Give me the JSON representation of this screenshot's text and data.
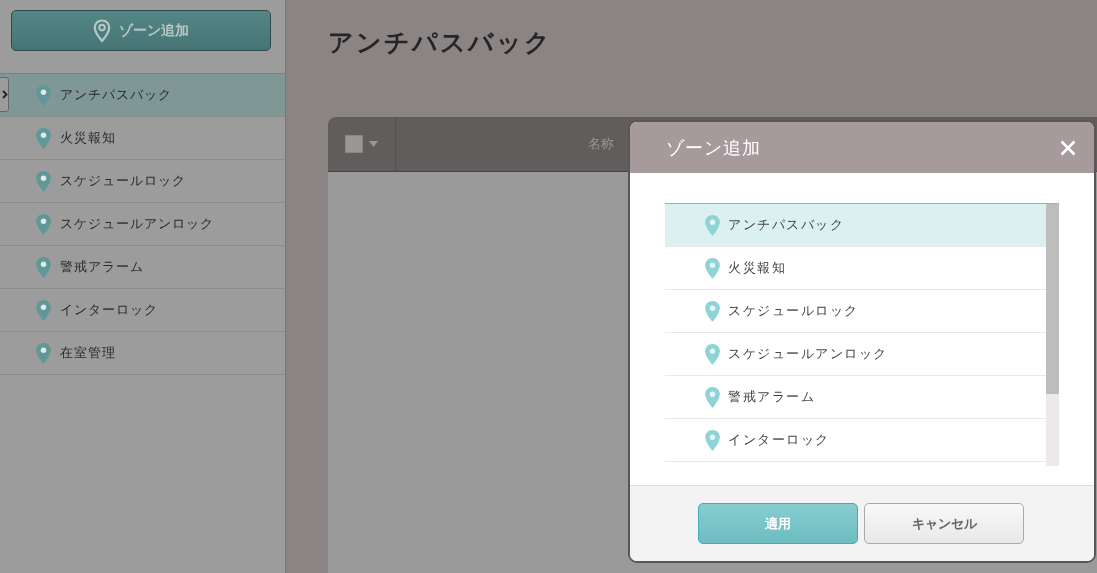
{
  "sidebar": {
    "add_button": "ゾーン追加",
    "zones": [
      {
        "label": "アンチパスバック",
        "selected": true
      },
      {
        "label": "火災報知",
        "selected": false
      },
      {
        "label": "スケジュールロック",
        "selected": false
      },
      {
        "label": "スケジュールアンロック",
        "selected": false
      },
      {
        "label": "警戒アラーム",
        "selected": false
      },
      {
        "label": "インターロック",
        "selected": false
      },
      {
        "label": "在室管理",
        "selected": false
      }
    ]
  },
  "page": {
    "title": "アンチパスバック",
    "table": {
      "select_all": {
        "checked": false
      },
      "columns": [
        "名称"
      ]
    }
  },
  "dialog": {
    "title": "ゾーン追加",
    "zones": [
      {
        "label": "アンチパスバック",
        "selected": true
      },
      {
        "label": "火災報知",
        "selected": false
      },
      {
        "label": "スケジュールロック",
        "selected": false
      },
      {
        "label": "スケジュールアンロック",
        "selected": false
      },
      {
        "label": "警戒アラーム",
        "selected": false
      },
      {
        "label": "インターロック",
        "selected": false
      }
    ],
    "buttons": [
      {
        "label": "適用",
        "kind": "primary"
      },
      {
        "label": "キャンセル",
        "kind": "secondary"
      }
    ]
  }
}
